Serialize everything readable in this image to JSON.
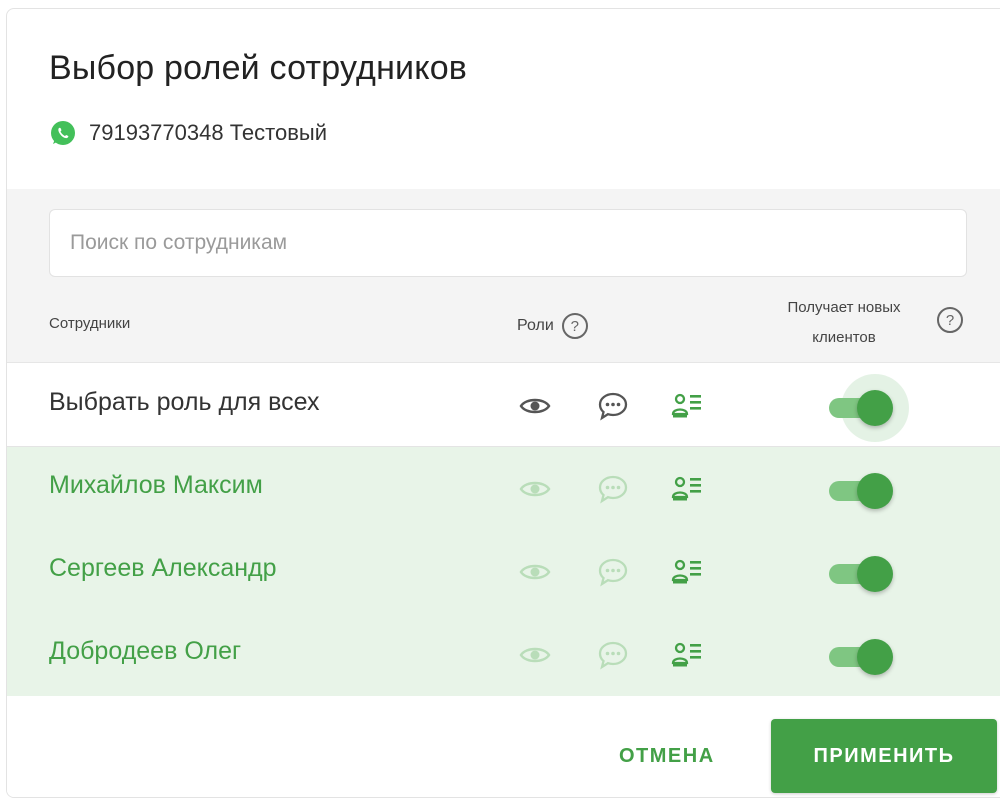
{
  "dialog": {
    "title": "Выбор ролей сотрудников",
    "account": "79193770348 Тестовый"
  },
  "search": {
    "placeholder": "Поиск по сотрудникам",
    "value": ""
  },
  "headers": {
    "employees": "Сотрудники",
    "roles": "Роли",
    "roles_help": "?",
    "new_clients": "Получает новых клиентов",
    "new_clients_help": "?"
  },
  "select_all": {
    "label": "Выбрать роль для всех",
    "receives_new_clients": true
  },
  "employees": [
    {
      "name": "Михайлов Максим",
      "receives_new_clients": true
    },
    {
      "name": "Сергеев Александр",
      "receives_new_clients": true
    },
    {
      "name": "Добродеев Олег",
      "receives_new_clients": true
    }
  ],
  "footer": {
    "cancel_label": "ОТМЕНА",
    "apply_label": "ПРИМЕНИТЬ"
  },
  "colors": {
    "accent": "#43a047",
    "row_selected_bg": "#e8f4e8",
    "header_bg": "#f4f4f4"
  },
  "icons": [
    "whatsapp-icon",
    "eye-icon",
    "chat-icon",
    "contact-card-icon",
    "help-icon"
  ]
}
